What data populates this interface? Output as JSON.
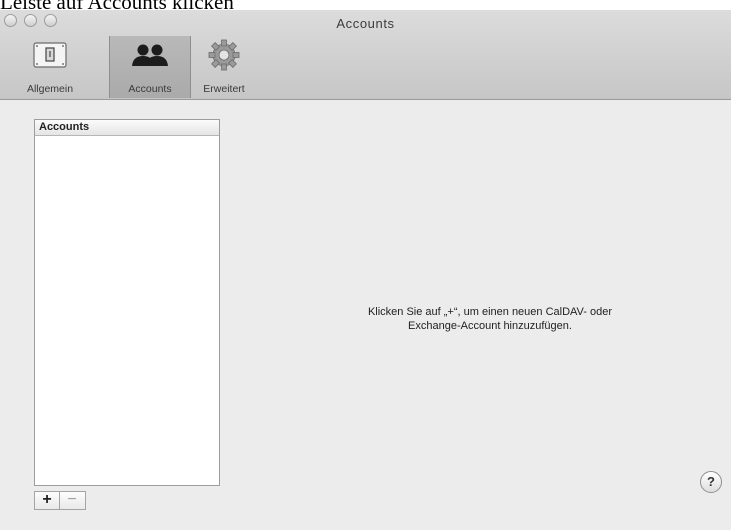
{
  "caption": "Leiste auf Accounts klicken",
  "window": {
    "title": "Accounts"
  },
  "toolbar": {
    "items": [
      {
        "label": "Allgemein",
        "icon": "switch-icon"
      },
      {
        "label": "Accounts",
        "icon": "people-icon",
        "selected": true
      },
      {
        "label": "Erweitert",
        "icon": "gear-icon"
      }
    ]
  },
  "accounts_list": {
    "header": "Accounts"
  },
  "list_buttons": {
    "add": "+",
    "remove": "−"
  },
  "message": {
    "line1": "Klicken Sie auf „+“, um einen neuen CalDAV- oder",
    "line2": "Exchange-Account hinzuzufügen."
  },
  "help": {
    "label": "?"
  },
  "colors": {
    "toolbar": "#cfcfcf",
    "window": "#ececec",
    "selected_tab": "#b0b0b0"
  }
}
